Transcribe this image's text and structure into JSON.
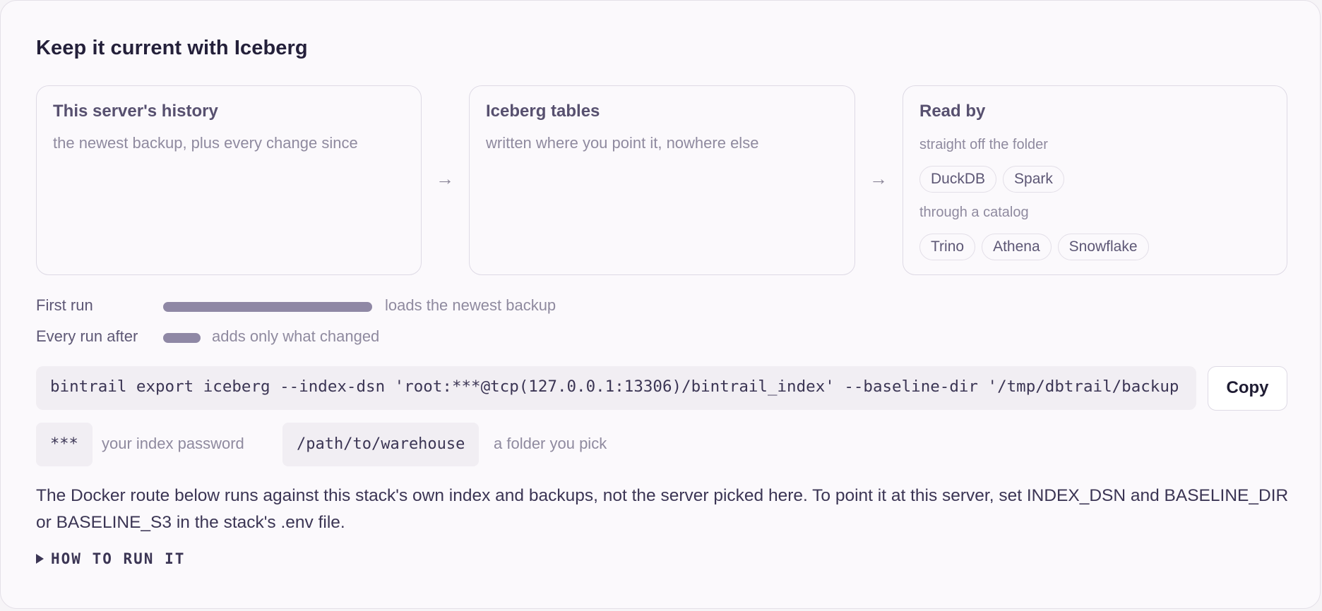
{
  "title": "Keep it current with Iceberg",
  "flow": {
    "source": {
      "title": "This server's history",
      "subtitle": "the newest backup, plus every change since"
    },
    "target": {
      "title": "Iceberg tables",
      "subtitle": "written where you point it, nowhere else"
    },
    "readers": {
      "title": "Read by",
      "direct_label": "straight off the folder",
      "direct": [
        "DuckDB",
        "Spark"
      ],
      "catalog_label": "through a catalog",
      "catalog": [
        "Trino",
        "Athena",
        "Snowflake"
      ]
    },
    "arrow_glyph": "→"
  },
  "runs": [
    {
      "label": "First run",
      "description": "loads the newest backup",
      "relative_size": 1.0
    },
    {
      "label": "Every run after",
      "description": "adds only what changed",
      "relative_size": 0.18
    }
  ],
  "command": {
    "text": "bintrail export iceberg --index-dsn 'root:***@tcp(127.0.0.1:13306)/bintrail_index' --baseline-dir '/tmp/dbtrail/backup",
    "copy_label": "Copy"
  },
  "placeholders": [
    {
      "code": "***",
      "description": "your index password"
    },
    {
      "code": "/path/to/warehouse",
      "description": "a folder you pick"
    }
  ],
  "note": "The Docker route below runs against this stack's own index and backups, not the server picked here. To point it at this server, set INDEX_DSN and BASELINE_DIR or BASELINE_S3 in the stack's .env file.",
  "details": {
    "label": "HOW TO RUN IT",
    "icon": "triangle-right-icon"
  },
  "colors": {
    "accent_bar": "#8f88a5",
    "card_bg": "#fbf9fc",
    "border": "#dedae5"
  }
}
